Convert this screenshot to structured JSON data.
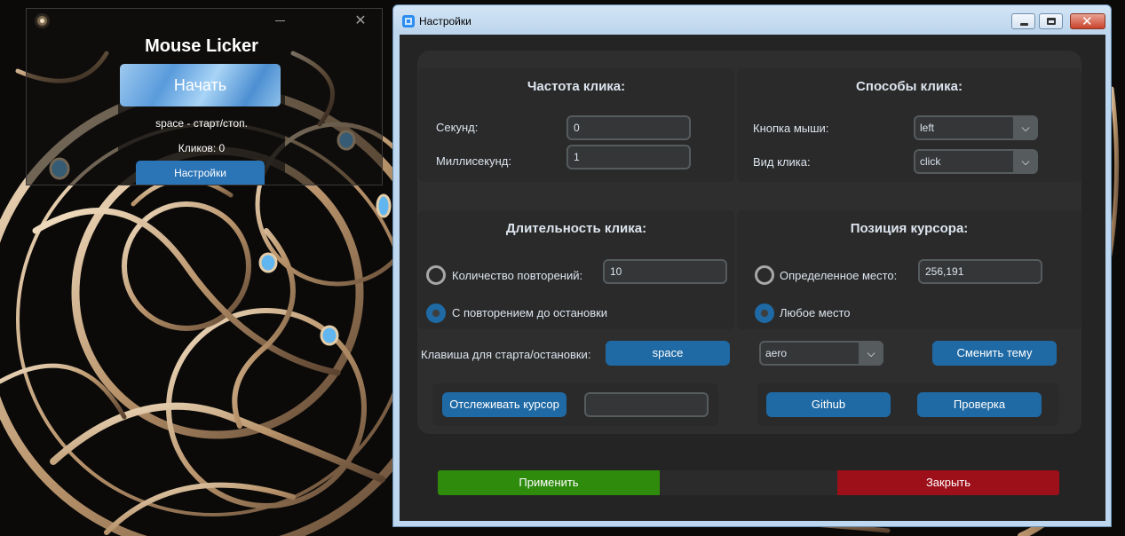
{
  "mouse_licker": {
    "title": "Mouse Licker",
    "start_button": "Начать",
    "hotkey_hint": "space - старт/стоп.",
    "clicks_label": "Кликов: 0",
    "settings_button": "Настройки"
  },
  "settings_window": {
    "title": "Настройки",
    "titlebar_buttons": {
      "minimize": "minimize-icon",
      "maximize": "maximize-icon",
      "close": "close-icon"
    },
    "click_rate": {
      "title": "Частота клика:",
      "seconds_label": "Секунд:",
      "seconds_value": "0",
      "milliseconds_label": "Миллисекунд:",
      "milliseconds_value": "1"
    },
    "click_methods": {
      "title": "Способы клика:",
      "mouse_button_label": "Кнопка мыши:",
      "mouse_button_value": "left",
      "click_type_label": "Вид клика:",
      "click_type_value": "click"
    },
    "click_duration": {
      "title": "Длительность клика:",
      "repeat_count_label": "Количество повторений:",
      "repeat_count_value": "10",
      "repeat_count_checked": false,
      "until_stopped_label": "С повторением до остановки",
      "until_stopped_checked": true
    },
    "cursor_position": {
      "title": "Позиция курсора:",
      "fixed_place_label": "Определенное место:",
      "fixed_place_value": "256,191",
      "fixed_place_checked": false,
      "any_place_label": "Любое место",
      "any_place_checked": true
    },
    "hotkey": {
      "label": "Клавиша для старта/остановки:",
      "button": "space"
    },
    "theme": {
      "value": "aero",
      "change_button": "Сменить тему"
    },
    "track_cursor_button": "Отслеживать курсор",
    "track_cursor_value": "",
    "github_button": "Github",
    "check_button": "Проверка",
    "apply_button": "Применить",
    "close_button": "Закрыть"
  },
  "colors": {
    "accent_button": "#1f6aa5",
    "apply": "#2e8b0c",
    "close": "#9d0f19",
    "panel": "#2a2a2a",
    "client": "#242424"
  }
}
